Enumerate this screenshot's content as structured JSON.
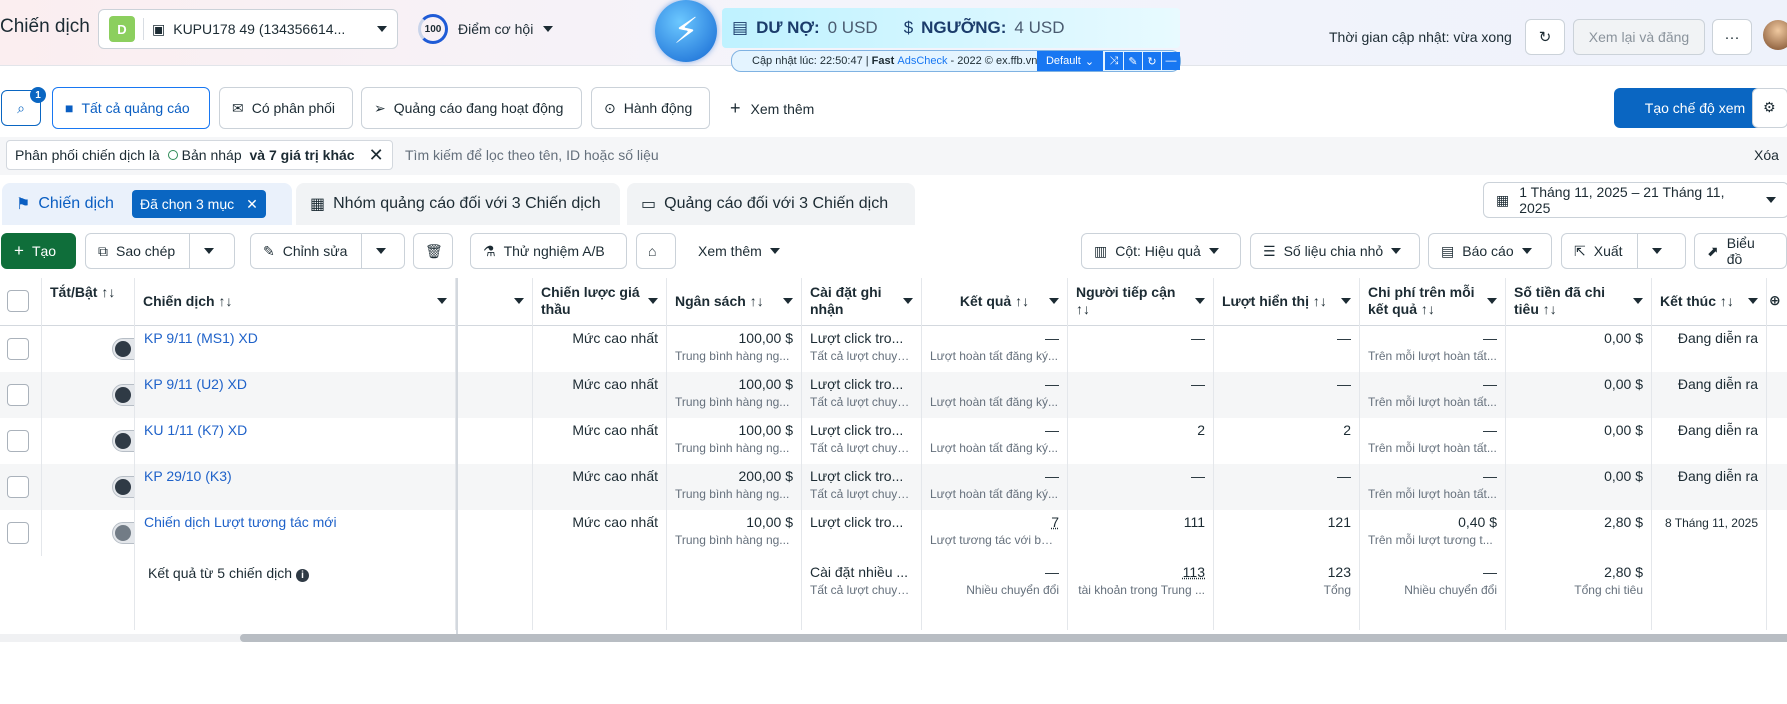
{
  "header": {
    "title": "Chiến dịch",
    "account_initial": "D",
    "account_name": "KUPU178 49 (134356614...",
    "score_value": "100",
    "score_label": "Điểm cơ hội",
    "debt_label": "DƯ NỢ:",
    "debt_value": "0 USD",
    "threshold_label": "NGƯỠNG:",
    "threshold_value": "4 USD",
    "strip_text_prefix": "Cập nhật lúc: 22:50:47 | ",
    "strip_brand_fast": "Fast",
    "strip_brand_ads": "AdsCheck",
    "strip_text_suffix": " - 2022 © ex.ffb.vn",
    "strip_select": "Default",
    "update_time": "Thời gian cập nhật: vừa xong",
    "review_button": "Xem lại và đăng",
    "more_glyph": "···"
  },
  "filter_tabs": {
    "search_badge": "1",
    "all_ads": "Tất cả quảng cáo",
    "delivering": "Có phân phối",
    "active_ads": "Quảng cáo đang hoạt động",
    "actions": "Hành động",
    "see_more": "Xem thêm",
    "create_view": "Tạo chế độ xem"
  },
  "filter": {
    "chip_prefix": "Phân phối chiến dịch là ",
    "chip_value": "Bản nháp",
    "chip_more": " và 7 giá trị khác",
    "placeholder": "Tìm kiếm để lọc theo tên, ID hoặc số liệu",
    "clear": "Xóa"
  },
  "level_tabs": {
    "campaigns": "Chiến dịch",
    "selected": "Đã chọn 3 mục",
    "adsets": "Nhóm quảng cáo đối với 3 Chiến dịch",
    "ads": "Quảng cáo đối với 3 Chiến dịch",
    "date_range": "1 Tháng 11, 2025 – 21 Tháng 11, 2025"
  },
  "toolbar": {
    "create": "Tạo",
    "copy": "Sao chép",
    "edit": "Chỉnh sửa",
    "ab_test": "Thử nghiệm A/B",
    "more": "Xem thêm",
    "columns": "Cột: Hiệu quả",
    "breakdown": "Số liệu chia nhỏ",
    "reports": "Báo cáo",
    "export": "Xuất",
    "charts": "Biểu đồ"
  },
  "table": {
    "columns": {
      "toggle": "Tắt/Bật ↑↓",
      "campaign": "Chiến dịch ↑↓",
      "bid": "Chiến lược giá thầu",
      "budget": "Ngân sách ↑↓",
      "attribution": "Cài đặt ghi nhận",
      "results": "Kết quả ↑↓",
      "reach": "Người tiếp cận ↑↓",
      "impressions": "Lượt hiển thị ↑↓",
      "cost_per": "Chi phí trên mỗi kết quả ↑↓",
      "spent": "Số tiền đã chi tiêu ↑↓",
      "end": "Kết thúc ↑↓"
    },
    "rows": [
      {
        "name": "KP 9/11 (MS1) XD",
        "bid": "Mức cao nhất",
        "budget": "100,00 $",
        "budget_sub": "Trung bình hàng ng...",
        "attr": "Lượt click tro...",
        "attr_sub": "Tất cả lượt chuyể...",
        "results": "—",
        "results_sub": "Lượt hoàn tất đăng ký...",
        "reach": "—",
        "impr": "—",
        "cpr": "—",
        "cpr_sub": "Trên mỗi lượt hoàn tất...",
        "spent": "0,00 $",
        "end": "Đang diễn ra"
      },
      {
        "name": "KP 9/11 (U2) XD",
        "bid": "Mức cao nhất",
        "budget": "100,00 $",
        "budget_sub": "Trung bình hàng ng...",
        "attr": "Lượt click tro...",
        "attr_sub": "Tất cả lượt chuyể...",
        "results": "—",
        "results_sub": "Lượt hoàn tất đăng ký...",
        "reach": "—",
        "impr": "—",
        "cpr": "—",
        "cpr_sub": "Trên mỗi lượt hoàn tất...",
        "spent": "0,00 $",
        "end": "Đang diễn ra"
      },
      {
        "name": "KU 1/11 (K7) XD",
        "bid": "Mức cao nhất",
        "budget": "100,00 $",
        "budget_sub": "Trung bình hàng ng...",
        "attr": "Lượt click tro...",
        "attr_sub": "Tất cả lượt chuyể...",
        "results": "—",
        "results_sub": "Lượt hoàn tất đăng ký...",
        "reach": "2",
        "impr": "2",
        "cpr": "—",
        "cpr_sub": "Trên mỗi lượt hoàn tất...",
        "spent": "0,00 $",
        "end": "Đang diễn ra"
      },
      {
        "name": "KP 29/10 (K3)",
        "bid": "Mức cao nhất",
        "budget": "200,00 $",
        "budget_sub": "Trung bình hàng ng...",
        "attr": "Lượt click tro...",
        "attr_sub": "Tất cả lượt chuyể...",
        "results": "—",
        "results_sub": "Lượt hoàn tất đăng ký...",
        "reach": "—",
        "impr": "—",
        "cpr": "—",
        "cpr_sub": "Trên mỗi lượt hoàn tất...",
        "spent": "0,00 $",
        "end": "Đang diễn ra"
      },
      {
        "name": "Chiến dịch Lượt tương tác mới",
        "bid": "Mức cao nhất",
        "budget": "10,00 $",
        "budget_sub": "Trung bình hàng ng...",
        "attr": "Lượt click tro...",
        "attr_sub": "",
        "results": "7",
        "results_sub": "Lượt tương tác với bài...",
        "reach": "111",
        "impr": "121",
        "cpr": "0,40 $",
        "cpr_sub": "Trên mỗi lượt tương t...",
        "spent": "2,80 $",
        "end": "8 Tháng 11, 2025"
      }
    ],
    "summary": {
      "label": "Kết quả từ 5 chiến dịch",
      "attr": "Cài đặt nhiều ...",
      "attr_sub": "Tất cả lượt chuyể...",
      "results": "—",
      "results_sub": "Nhiều chuyển đổi",
      "reach": "113",
      "reach_sub": "tài khoản trong Trung ...",
      "impr": "123",
      "impr_sub": "Tổng",
      "cpr": "—",
      "cpr_sub": "Nhiều chuyển đổi",
      "spent": "2,80 $",
      "spent_sub": "Tổng chi tiêu"
    }
  }
}
